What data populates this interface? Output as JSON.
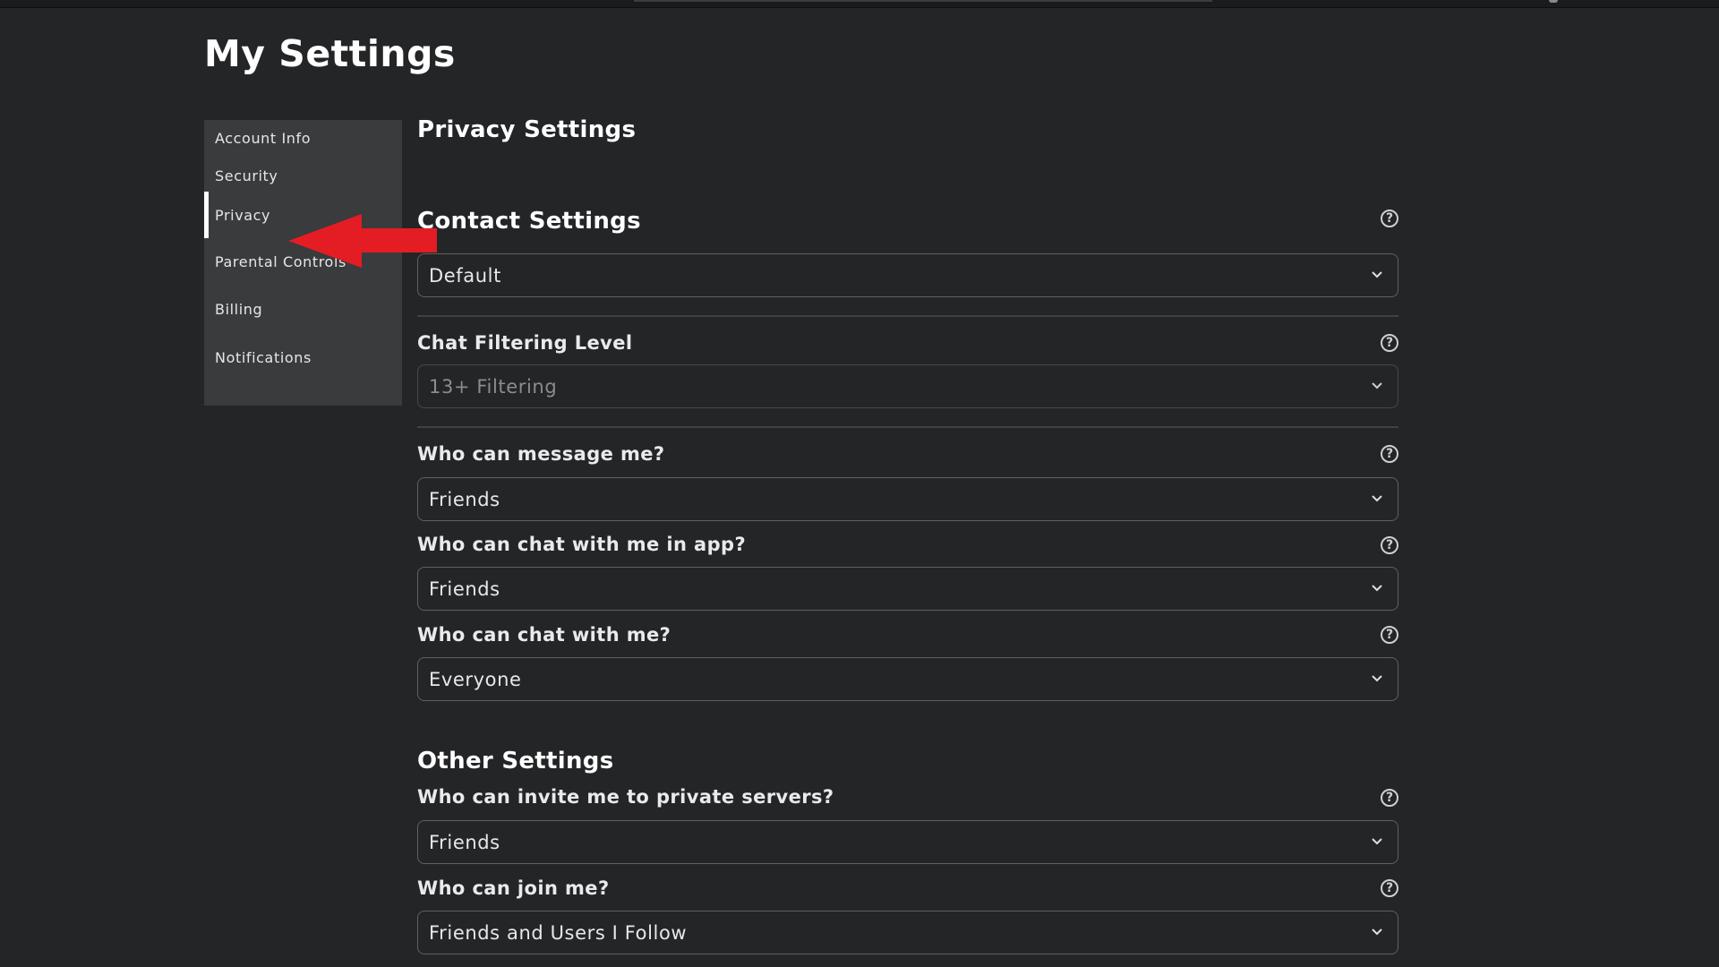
{
  "page": {
    "title": "My Settings"
  },
  "sidebar": {
    "items": [
      {
        "label": "Account Info"
      },
      {
        "label": "Security"
      },
      {
        "label": "Privacy",
        "active": true
      },
      {
        "label": "Parental Controls"
      },
      {
        "label": "Billing"
      },
      {
        "label": "Notifications"
      }
    ]
  },
  "annotation": {
    "type": "red-arrow",
    "points_to": "Privacy",
    "color": "#e41c24"
  },
  "main": {
    "heading": "Privacy Settings",
    "contact_section": {
      "title": "Contact Settings",
      "value": "Default"
    },
    "chat_filtering": {
      "label": "Chat Filtering Level",
      "value": "13+ Filtering",
      "disabled": true
    },
    "message": {
      "label": "Who can message me?",
      "value": "Friends"
    },
    "chat_in_app": {
      "label": "Who can chat with me in app?",
      "value": "Friends"
    },
    "chat": {
      "label": "Who can chat with me?",
      "value": "Everyone"
    },
    "other_section": {
      "title": "Other Settings"
    },
    "invite": {
      "label": "Who can invite me to private servers?",
      "value": "Friends"
    },
    "join": {
      "label": "Who can join me?",
      "value": "Friends and Users I Follow"
    },
    "help_glyph": "?"
  },
  "colors": {
    "background": "#232527",
    "sidebar": "#393b3d",
    "text": "#ffffff",
    "accent_arrow": "#e41c24"
  }
}
